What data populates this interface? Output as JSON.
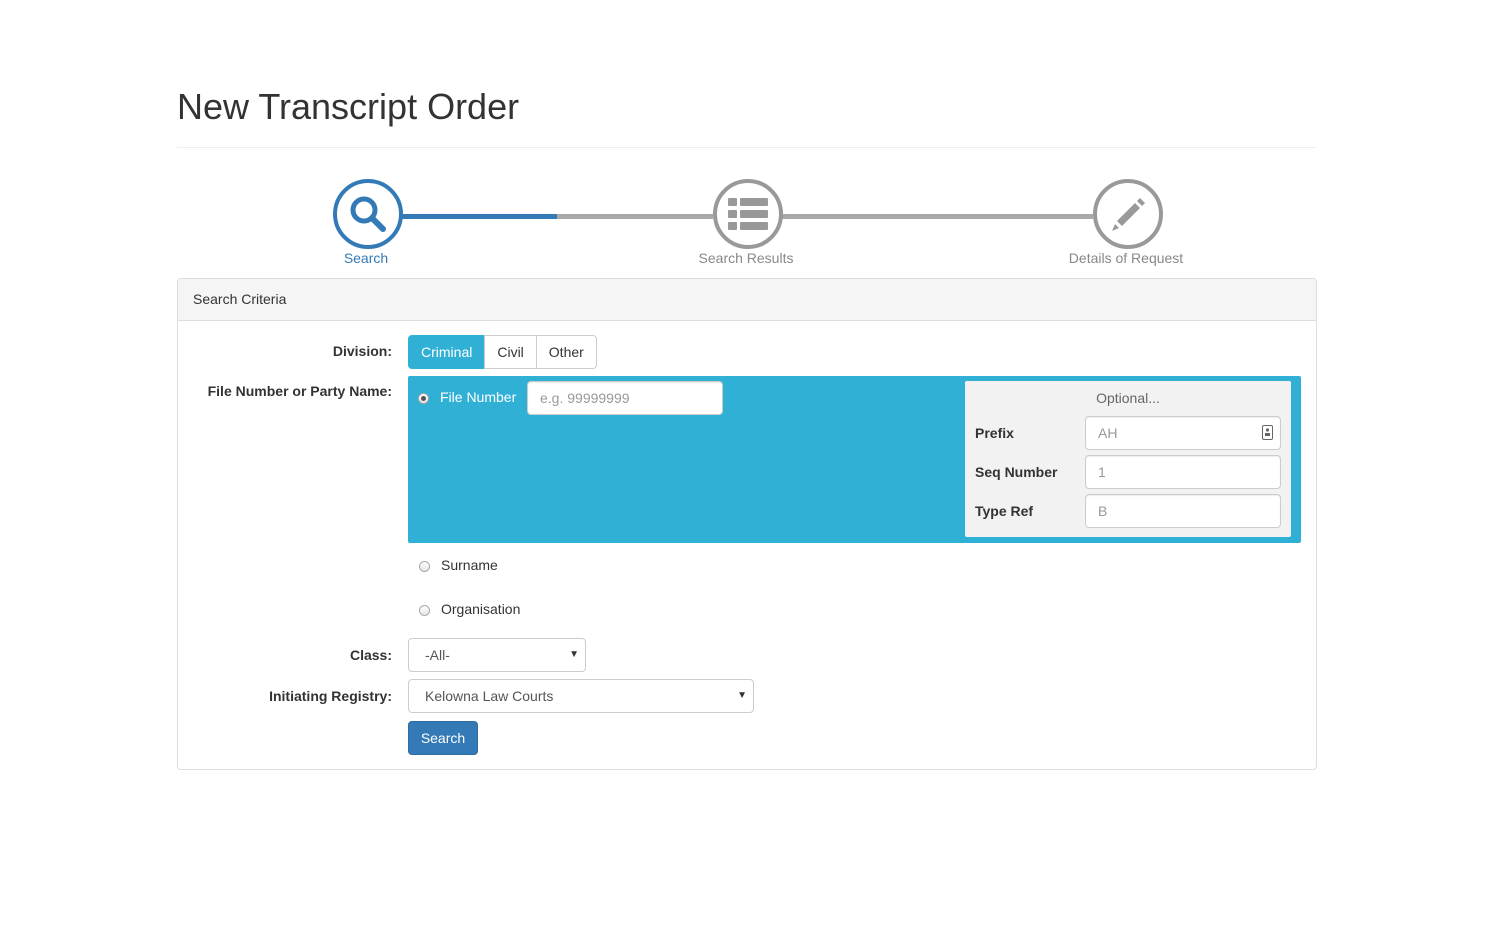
{
  "page": {
    "title": "New Transcript Order"
  },
  "stepper": {
    "steps": [
      {
        "label": "Search",
        "icon": "search-icon",
        "state": "active"
      },
      {
        "label": "Search Results",
        "icon": "list-icon",
        "state": "inactive"
      },
      {
        "label": "Details of Request",
        "icon": "pencil-icon",
        "state": "inactive"
      }
    ],
    "colors": {
      "active": "#337ab7",
      "inactive": "#999999"
    }
  },
  "panel": {
    "heading": "Search Criteria",
    "division": {
      "label": "Division:",
      "options": [
        "Criminal",
        "Civil",
        "Other"
      ],
      "selected": "Criminal"
    },
    "file_or_party": {
      "label": "File Number or Party Name:",
      "options": [
        "File Number",
        "Surname",
        "Organisation"
      ],
      "selected": "File Number",
      "file_number_placeholder": "e.g. 99999999",
      "optional": {
        "heading": "Optional...",
        "prefix_label": "Prefix",
        "prefix_placeholder": "AH",
        "seq_label": "Seq Number",
        "seq_placeholder": "1",
        "type_label": "Type Ref",
        "type_placeholder": "B"
      }
    },
    "class": {
      "label": "Class:",
      "value": "-All-"
    },
    "registry": {
      "label": "Initiating Registry:",
      "value": "Kelowna Law Courts"
    },
    "search_button": "Search"
  },
  "colors": {
    "accent_blue": "#31b0d5",
    "primary": "#337ab7"
  }
}
